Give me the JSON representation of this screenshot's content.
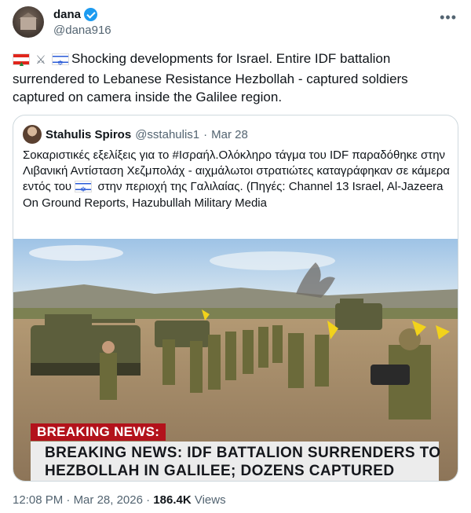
{
  "author": {
    "name": "dana",
    "handle": "@dana916",
    "verified": true,
    "avatar_icon": "house-avatar-icon"
  },
  "more_icon": "more-horizontal-icon",
  "tweet": {
    "emoji_prefix": [
      "lebanon-flag-icon",
      "crossed-swords-icon",
      "israel-flag-icon"
    ],
    "text": "Shocking developments for Israel. Entire IDF battalion surrendered to Lebanese Resistance Hezbollah - captured soldiers captured on camera inside the Galilee region."
  },
  "quoted": {
    "name": "Stahulis Spiros",
    "handle": "@sstahulis1",
    "separator": "·",
    "date": "Mar 28",
    "text_before_flag": "Σοκαριστικές εξελίξεις για το #Ισραήλ.Ολόκληρο τάγμα του IDF παραδόθηκε στην Λιβανική Αντίσταση Χεζμπολάχ - αιχμάλωτοι στρατιώτες καταγράφηκαν σε κάμερα εντός του",
    "text_after_flag": "στην περιοχή της Γαλιλαίας. (Πηγές: Channel 13 Israel, Al-Jazeera On Ground Reports, Hazubullah Military Media",
    "image": {
      "banner_tag": "BREAKING NEWS:",
      "headline_line1": "BREAKING NEWS: IDF BATTALION SURRENDERS TO",
      "headline_line2": "HEZBOLLAH IN GALILEE; DOZENS CAPTURED",
      "colors": {
        "banner_red": "#b3121b",
        "banner_bg": "#ececec",
        "flag_yellow": "#f2d21b",
        "uniform_olive": "#6b6a3a"
      }
    }
  },
  "meta": {
    "time": "12:08 PM",
    "separator": "·",
    "date": "Mar 28, 2026",
    "views_count": "186.4K",
    "views_label": "Views"
  }
}
